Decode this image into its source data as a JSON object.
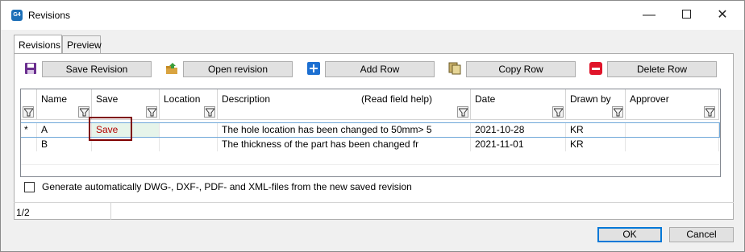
{
  "window": {
    "title": "Revisions",
    "app_badge": "G4"
  },
  "tabs": [
    {
      "label": "Revisions"
    },
    {
      "label": "Preview"
    }
  ],
  "toolbar": {
    "save_revision": "Save Revision",
    "open_revision": "Open revision",
    "add_row": "Add Row",
    "copy_row": "Copy Row",
    "delete_row": "Delete Row"
  },
  "icons": {
    "save": "floppy-disk-icon",
    "open": "folder-open-icon",
    "add": "plus-icon",
    "copy": "copy-icon",
    "delete": "minus-icon",
    "filter": "funnel-icon"
  },
  "colors": {
    "accent": "#1c6fb7",
    "save_text": "#b40000",
    "highlight_border": "#7f0000",
    "delete_red": "#e0142a"
  },
  "grid": {
    "columns": {
      "name": "Name",
      "save": "Save",
      "location": "Location",
      "description": "Description",
      "description_help": "(Read field help)",
      "date": "Date",
      "drawn_by": "Drawn by",
      "approver": "Approver"
    },
    "rows": [
      {
        "marker": "*",
        "name": "A",
        "save": "Save",
        "location": "",
        "description": "The hole location has been changed to 50mm> 5",
        "date": "2021-10-28",
        "drawn_by": "KR",
        "approver": ""
      },
      {
        "marker": "",
        "name": "B",
        "save": "",
        "location": "",
        "description": "The thickness of the part has been changed fr",
        "date": "2021-11-01",
        "drawn_by": "KR",
        "approver": ""
      }
    ]
  },
  "option": {
    "label": "Generate automatically DWG-, DXF-, PDF- and XML-files from the new saved revision",
    "checked": false
  },
  "status": {
    "page": "1/2"
  },
  "dialog": {
    "ok": "OK",
    "cancel": "Cancel"
  }
}
